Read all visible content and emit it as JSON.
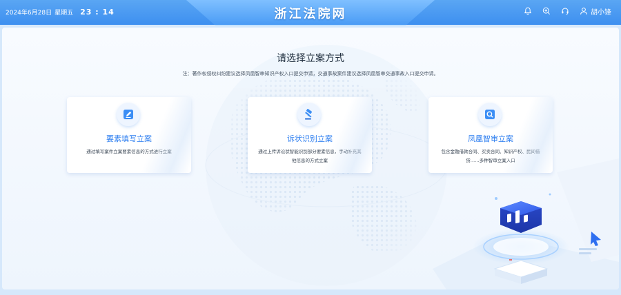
{
  "header": {
    "date": "2024年6月28日",
    "weekday": "星期五",
    "time": "23 : 14",
    "site_title": "浙江法院网",
    "icons": [
      "bell-icon",
      "zoom-in-icon",
      "headset-icon",
      "user-icon"
    ],
    "username": "胡小锋"
  },
  "main": {
    "heading": "请选择立案方式",
    "notice": "注：著作权侵权纠纷建议选择凤凰智审知识产权入口提交申请，交通事故案件建议选择凤凰智审交通事故入口提交申请。",
    "cards": [
      {
        "icon": "edit-icon",
        "title": "要素填写立案",
        "desc": "通过填写案件立案要素信息的方式进行立案"
      },
      {
        "icon": "gavel-icon",
        "title": "诉状识别立案",
        "desc": "通过上传诉讼状智能识别部分要素信息，手动补充其他信息的方式立案"
      },
      {
        "icon": "search-icon",
        "title": "凤凰智审立案",
        "desc": "包含金融借款合同、买卖合同、知识产权、民间借贷……多种智审立案入口"
      }
    ]
  },
  "colors": {
    "header_blue": "#3d8ff0",
    "accent": "#2f7ff0",
    "panel_bg": "#f4f8fd"
  }
}
